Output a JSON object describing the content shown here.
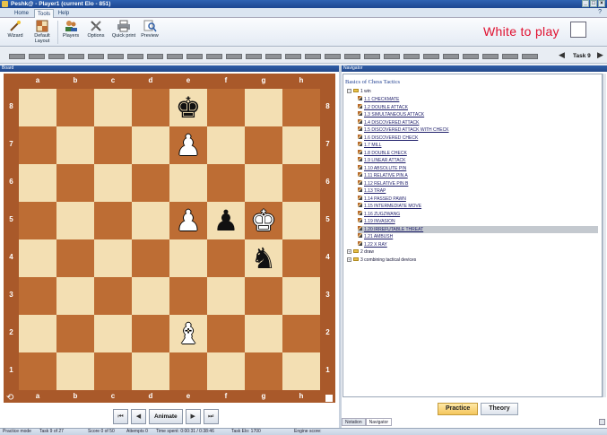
{
  "window": {
    "title": "Peshk@ - Player1 (current Elo - 851)",
    "min": "_",
    "max": "□",
    "close": "×"
  },
  "tabs": [
    {
      "label": "Home"
    },
    {
      "label": "Tools"
    },
    {
      "label": "Help"
    }
  ],
  "help_icon": "?",
  "ribbon": {
    "buttons": [
      {
        "label": "Wizard",
        "icon": "wand-icon"
      },
      {
        "label": "Default Layout",
        "icon": "layout-icon"
      },
      {
        "label": "Players",
        "icon": "players-icon"
      },
      {
        "label": "Options",
        "icon": "tools-icon"
      },
      {
        "label": "Quick print",
        "icon": "printer-icon"
      },
      {
        "label": "Preview",
        "icon": "magnifier-icon"
      }
    ]
  },
  "turn_indicator": "White to play",
  "taskbar": {
    "label": "Task 9",
    "prev": "◀",
    "next": "▶",
    "segments": 27
  },
  "board_panel": {
    "title": "Board"
  },
  "board": {
    "files": [
      "a",
      "b",
      "c",
      "d",
      "e",
      "f",
      "g",
      "h"
    ],
    "ranks": [
      "8",
      "7",
      "6",
      "5",
      "4",
      "3",
      "2",
      "1"
    ],
    "pieces": [
      {
        "square": "e8",
        "glyph": "♚",
        "color": "black",
        "name": "king"
      },
      {
        "square": "e7",
        "glyph": "♟",
        "color": "white",
        "name": "pawn"
      },
      {
        "square": "e5",
        "glyph": "♟",
        "color": "white",
        "name": "pawn"
      },
      {
        "square": "f5",
        "glyph": "♟",
        "color": "black",
        "name": "pawn"
      },
      {
        "square": "g5",
        "glyph": "♚",
        "color": "white",
        "name": "king"
      },
      {
        "square": "g4",
        "glyph": "♞",
        "color": "black",
        "name": "knight"
      },
      {
        "square": "e2",
        "glyph": "♝",
        "color": "white",
        "name": "bishop"
      }
    ],
    "rotate_icon": "⟲",
    "light_color": "#f3dfb3",
    "dark_color": "#bd6d34",
    "frame_color": "#a9592a"
  },
  "nav_buttons": {
    "first": "⏮",
    "prev": "◀",
    "animate": "Animate",
    "next": "▶",
    "last": "⏭"
  },
  "navigator": {
    "title": "Navigator",
    "tree_title": "Basics of Chess Tactics",
    "root": "1 win",
    "items": [
      "1.1 CHECKMATE",
      "1.2 DOUBLE ATTACK",
      "1.3 SIMULTANEOUS ATTACK",
      "1.4 DISCOVERED ATTACK",
      "1.5 DISCOVERED ATTACK WITH CHECK",
      "1.6 DISCOVERED CHECK",
      "1.7 MILL",
      "1.8 DOUBLE CHECK",
      "1.9 LINEAR ATTACK",
      "1.10 ABSOLUTE PIN",
      "1.11 RELATIVE PIN A",
      "1.12 RELATIVE PIN B",
      "1.13 TRAP",
      "1.14 PASSED PAWN",
      "1.15 INTERMEDIATE MOVE",
      "1.16 ZUGZWANG",
      "1.19 INVASION",
      "1.20 IRREFUTABLE THREAT",
      "1.21 AMBUSH",
      "1.22 X RAY"
    ],
    "selected_index": 17,
    "other_roots": [
      "2 draw",
      "3 combining tactical devices"
    ],
    "practice": "Practice",
    "theory": "Theory",
    "bottom_tabs": [
      "Notation",
      "Navigator"
    ]
  },
  "statusbar": {
    "mode": "Practice mode",
    "task": "Task 9 of 27",
    "score": "Score 0 of 50",
    "attempts": "Attempts 0",
    "time": "Time spent: 0:00:31 / 0:38:46",
    "elo": "Task Elo: 1700",
    "engine": "Engine score:"
  }
}
